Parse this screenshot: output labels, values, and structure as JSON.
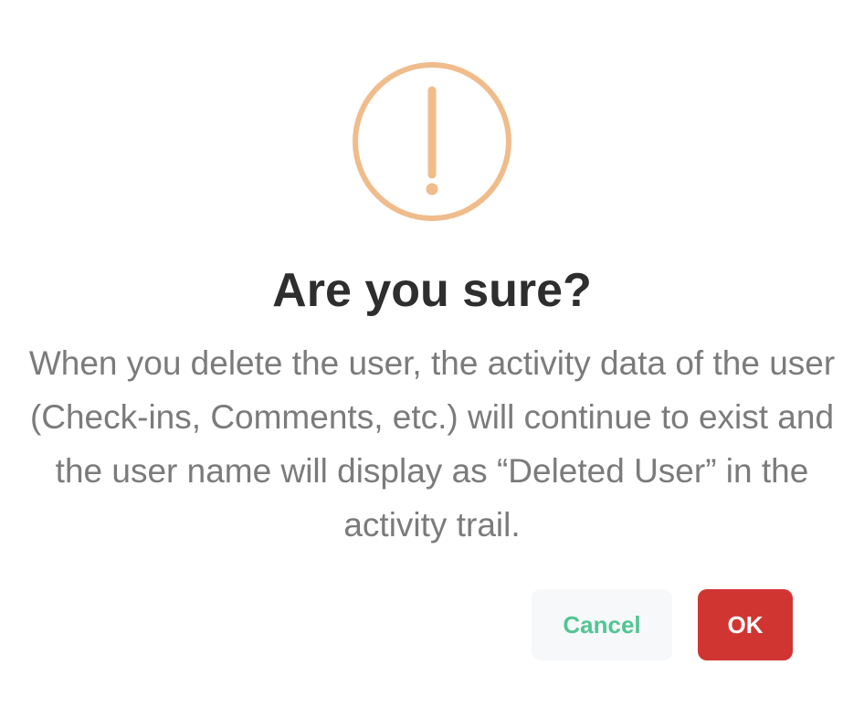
{
  "dialog": {
    "icon": "warning-exclamation-icon",
    "icon_color": "#f0bc8b",
    "title": "Are you sure?",
    "message": "When you delete the user, the activity data of the user (Check-ins, Comments, etc.) will continue to exist and the user name will display as “Deleted User” in the activity trail.",
    "cancel_label": "Cancel",
    "ok_label": "OK"
  },
  "colors": {
    "cancel_text": "#52c593",
    "cancel_bg": "#f6f8fa",
    "ok_bg": "#d13532",
    "title": "#2e2e2e",
    "message": "#7b7b7b"
  }
}
